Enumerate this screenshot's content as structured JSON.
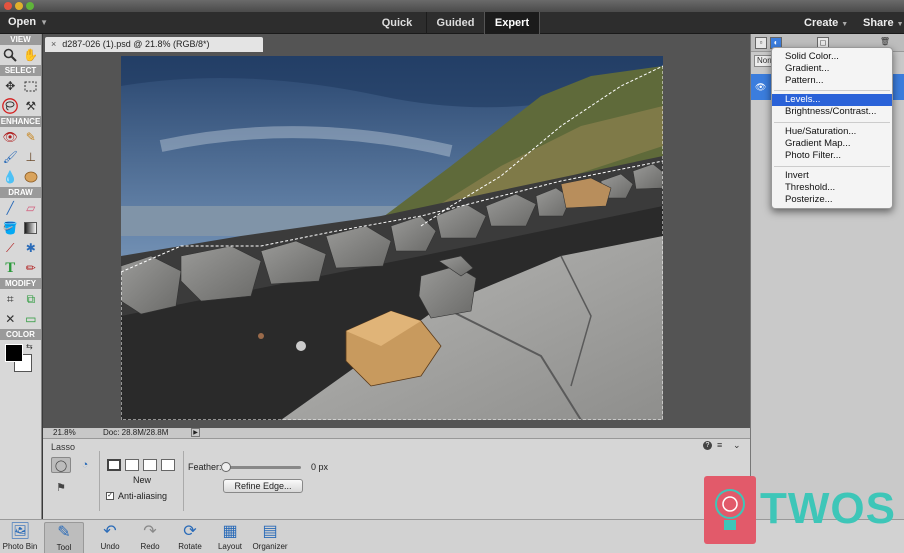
{
  "menubar": {
    "open_label": "Open",
    "modes": [
      "Quick",
      "Guided",
      "Expert"
    ],
    "active_mode": "Expert",
    "create_label": "Create",
    "share_label": "Share"
  },
  "toolbox": {
    "sections": [
      "VIEW",
      "SELECT",
      "ENHANCE",
      "DRAW",
      "MODIFY",
      "COLOR"
    ]
  },
  "document": {
    "tab_title": "d287-026 (1).psd @ 21.8% (RGB/8*)",
    "zoom": "21.8%",
    "doc_size": "Doc: 28.8M/28.8M"
  },
  "options": {
    "tool_name": "Lasso",
    "new_label": "New",
    "feather_label": "Feather:",
    "feather_value": "0 px",
    "refine_label": "Refine Edge...",
    "anti_alias_label": "Anti-aliasing"
  },
  "bottombar": {
    "items": [
      "Photo Bin",
      "Tool Options",
      "Undo",
      "Redo",
      "Rotate",
      "Layout",
      "Organizer"
    ]
  },
  "layers": {
    "blend_mode": "Normal"
  },
  "adjust_menu": {
    "group1": [
      "Solid Color...",
      "Gradient...",
      "Pattern..."
    ],
    "group2": [
      "Levels...",
      "Brightness/Contrast..."
    ],
    "group3": [
      "Hue/Saturation...",
      "Gradient Map...",
      "Photo Filter..."
    ],
    "group4": [
      "Invert",
      "Threshold...",
      "Posterize..."
    ],
    "highlighted": "Levels..."
  },
  "watermark": {
    "text": "TWOS"
  },
  "colors": {
    "accent": "#2a62d8",
    "layer_selected": "#3b7ddd",
    "watermark_pink": "#e25a6a",
    "watermark_teal": "#3ec6b8"
  }
}
